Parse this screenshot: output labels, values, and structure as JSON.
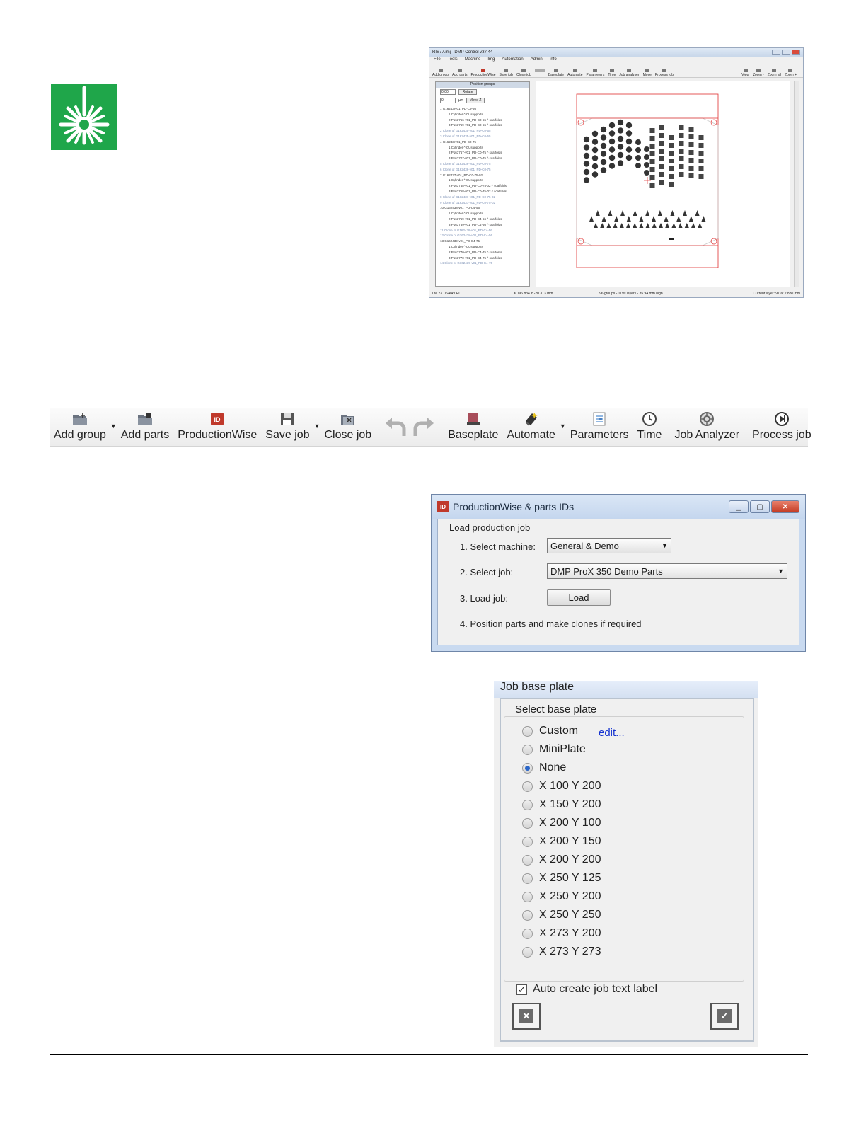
{
  "main_window": {
    "title": "RIS77.imj - DMP Control v37.44",
    "menu": [
      "File",
      "Tools",
      "Machine",
      "Img",
      "Automation",
      "Admin",
      "Info"
    ],
    "toolbar_items": [
      "Add group",
      "Add parts",
      "ProductionWise",
      "Save job",
      "Close job",
      "Baseplate",
      "Automate",
      "Parameters",
      "Time",
      "Job analyser",
      "Move",
      "Process job"
    ],
    "right_toolbar_items": [
      "View",
      "Zoom -",
      "Zoom all",
      "Zoom +"
    ],
    "panel_header": "Position groups",
    "rotate_value": "0.00",
    "rotate_label": "Rotate",
    "move_value": "0",
    "move_unit": "µm",
    "move_label": "Move Z",
    "tree": [
      {
        "t": "1 G16243rv01_PD-C9-56",
        "k": "g"
      },
      {
        "t": "1 Cylinder ^ CUsupports",
        "k": "s"
      },
      {
        "t": "2 P163766-v01_PD-C0-55 ^ scaffolds",
        "k": "s"
      },
      {
        "t": "3 P163769-v01_PD-C0-55 ^ scaffolds",
        "k": "s"
      },
      {
        "t": "2 Clone of G162435-v01_PD-C0-55",
        "k": "c"
      },
      {
        "t": "3 Clone of G162435-v01_PD-C0-55",
        "k": "c"
      },
      {
        "t": "4 G16243rv01_PD-C0-75",
        "k": "g"
      },
      {
        "t": "1 Cylinder ^ CUsupports",
        "k": "s"
      },
      {
        "t": "2 P163767-v01_PD-C0-75 ^ scaffolds",
        "k": "s"
      },
      {
        "t": "3 P163707-v01_PD-C0-75 ^ scaffolds",
        "k": "s"
      },
      {
        "t": "5 Clone of G162436-v01_PD-C0-75",
        "k": "c"
      },
      {
        "t": "6 Clone of G162436-v01_PD-C0-75",
        "k": "c"
      },
      {
        "t": "7 G162437-v01_PD-C0-75-02",
        "k": "g"
      },
      {
        "t": "1 Cylinder ^ CUsupports",
        "k": "s"
      },
      {
        "t": "2 P163768-v01_PD-C0-75-02 ^ scaffolds",
        "k": "s"
      },
      {
        "t": "3 P163768-v01_PD-C0-75-02 ^ scaffolds",
        "k": "s"
      },
      {
        "t": "8 Clone of G162437-v01_PD-C0-75-02",
        "k": "c"
      },
      {
        "t": "9 Clone of G162437-v01_PD-C0-75-02",
        "k": "c"
      },
      {
        "t": "10 G162438-v01_PD-C4-56",
        "k": "g"
      },
      {
        "t": "1 Cylinder ^ CUsupports",
        "k": "s"
      },
      {
        "t": "2 P163769-v01_PD-C4-56 ^ scaffolds",
        "k": "s"
      },
      {
        "t": "3 P163769-v01_PD-C4-56 ^ scaffolds",
        "k": "s"
      },
      {
        "t": "11 Clone of G162438-v01_PD-C4-56",
        "k": "c"
      },
      {
        "t": "12 Clone of G162438-v01_PD-C4-56",
        "k": "c"
      },
      {
        "t": "13 G162439-v01_PD-C4-75",
        "k": "g"
      },
      {
        "t": "1 Cylinder ^ CUsupports",
        "k": "s"
      },
      {
        "t": "2 P163770-v01_PD-C4-75 ^ scaffolds",
        "k": "s"
      },
      {
        "t": "3 P163770-v01_PD-C4-75 ^ scaffolds",
        "k": "s"
      },
      {
        "t": "14 Clone of G162439-v01_PD-C4-75",
        "k": "c"
      }
    ],
    "status": {
      "left": "LM 23 Ti6Al4V ELI",
      "coords": "X 196.834  Y -20.313 mm",
      "groups": "96 groups - 1199 layers - 35.94 mm high",
      "layer": "Current layer: 97 at 2.880 mm"
    }
  },
  "toolbar": {
    "add_group": "Add group",
    "add_parts": "Add parts",
    "productionwise": "ProductionWise",
    "save_job": "Save job",
    "close_job": "Close job",
    "baseplate": "Baseplate",
    "automate": "Automate",
    "parameters": "Parameters",
    "time": "Time",
    "job_analyzer": "Job Analyzer",
    "process_job": "Process job",
    "icon_names": [
      "folder-add-icon",
      "folder-parts-icon",
      "productionwise-id-icon",
      "floppy-disk-icon",
      "close-folder-icon",
      "undo-icon",
      "redo-icon",
      "baseplate-icon",
      "automate-wizard-icon",
      "parameters-icon",
      "clock-icon",
      "job-analyzer-icon",
      "process-job-icon"
    ]
  },
  "productionwise_dialog": {
    "title": "ProductionWise & parts IDs",
    "group_title": "Load production job",
    "step1_label": "1. Select machine:",
    "machine_value": "General & Demo",
    "step2_label": "2. Select job:",
    "job_value": "DMP ProX 350 Demo Parts",
    "step3_label": "3. Load job:",
    "load_button": "Load",
    "step4_label": "4. Position parts and make clones if required",
    "app_icon_text": "ID"
  },
  "baseplate_dialog": {
    "title": "Job base plate",
    "group_title": "Select base plate",
    "edit_link": "edit...",
    "options": [
      "Custom",
      "MiniPlate",
      "None",
      "X 100  Y 200",
      "X 150  Y 200",
      "X 200  Y 100",
      "X 200  Y 150",
      "X 200  Y 200",
      "X 250  Y 125",
      "X 250  Y 200",
      "X 250  Y 250",
      "X 273  Y 200",
      "X 273  Y 273"
    ],
    "selected": "None",
    "checkbox_label": "Auto create job text label",
    "checkbox_checked": true
  },
  "colors": {
    "logo_green": "#1fa64a",
    "build_outline": "#e03030",
    "link_blue": "#1533d0"
  }
}
